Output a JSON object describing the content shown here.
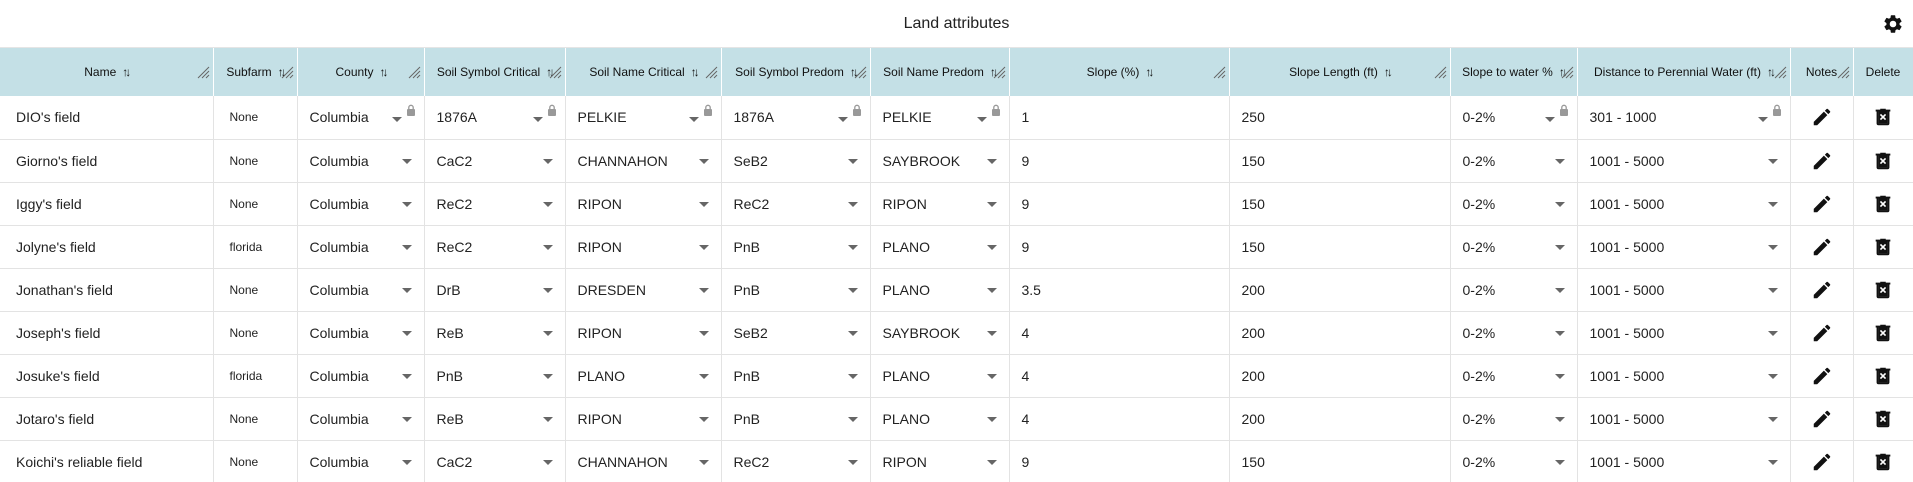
{
  "title": "Land attributes",
  "icons": {
    "settings": "gear-icon",
    "notes": "pencil-icon",
    "delete": "trash-x-icon",
    "lock": "lock-icon",
    "sort": "sort-arrows-icon"
  },
  "headers": [
    "Name",
    "Subfarm",
    "County",
    "Soil Symbol Critical",
    "Soil Name Critical",
    "Soil Symbol Predom",
    "Soil Name Predom",
    "Slope (%)",
    "Slope Length (ft)",
    "Slope to water %",
    "Distance to Perennial Water (ft)",
    "Notes",
    "Delete"
  ],
  "rows": [
    {
      "name": "DIO's field",
      "subfarm": "None",
      "county": "Columbia",
      "ssc": "1876A",
      "snc": "PELKIE",
      "ssp": "1876A",
      "snp": "PELKIE",
      "slope": "1",
      "slope_len": "250",
      "slope_water": "0-2%",
      "distance": "301 - 1000",
      "locked": true
    },
    {
      "name": "Giorno's field",
      "subfarm": "None",
      "county": "Columbia",
      "ssc": "CaC2",
      "snc": "CHANNAHON",
      "ssp": "SeB2",
      "snp": "SAYBROOK",
      "slope": "9",
      "slope_len": "150",
      "slope_water": "0-2%",
      "distance": "1001 - 5000",
      "locked": false
    },
    {
      "name": "Iggy's field",
      "subfarm": "None",
      "county": "Columbia",
      "ssc": "ReC2",
      "snc": "RIPON",
      "ssp": "ReC2",
      "snp": "RIPON",
      "slope": "9",
      "slope_len": "150",
      "slope_water": "0-2%",
      "distance": "1001 - 5000",
      "locked": false
    },
    {
      "name": "Jolyne's field",
      "subfarm": "florida",
      "county": "Columbia",
      "ssc": "ReC2",
      "snc": "RIPON",
      "ssp": "PnB",
      "snp": "PLANO",
      "slope": "9",
      "slope_len": "150",
      "slope_water": "0-2%",
      "distance": "1001 - 5000",
      "locked": false
    },
    {
      "name": "Jonathan's field",
      "subfarm": "None",
      "county": "Columbia",
      "ssc": "DrB",
      "snc": "DRESDEN",
      "ssp": "PnB",
      "snp": "PLANO",
      "slope": "3.5",
      "slope_len": "200",
      "slope_water": "0-2%",
      "distance": "1001 - 5000",
      "locked": false
    },
    {
      "name": "Joseph's field",
      "subfarm": "None",
      "county": "Columbia",
      "ssc": "ReB",
      "snc": "RIPON",
      "ssp": "SeB2",
      "snp": "SAYBROOK",
      "slope": "4",
      "slope_len": "200",
      "slope_water": "0-2%",
      "distance": "1001 - 5000",
      "locked": false
    },
    {
      "name": "Josuke's field",
      "subfarm": "florida",
      "county": "Columbia",
      "ssc": "PnB",
      "snc": "PLANO",
      "ssp": "PnB",
      "snp": "PLANO",
      "slope": "4",
      "slope_len": "200",
      "slope_water": "0-2%",
      "distance": "1001 - 5000",
      "locked": false
    },
    {
      "name": "Jotaro's field",
      "subfarm": "None",
      "county": "Columbia",
      "ssc": "ReB",
      "snc": "RIPON",
      "ssp": "PnB",
      "snp": "PLANO",
      "slope": "4",
      "slope_len": "200",
      "slope_water": "0-2%",
      "distance": "1001 - 5000",
      "locked": false
    },
    {
      "name": "Koichi's reliable field",
      "subfarm": "None",
      "county": "Columbia",
      "ssc": "CaC2",
      "snc": "CHANNAHON",
      "ssp": "ReC2",
      "snp": "RIPON",
      "slope": "9",
      "slope_len": "150",
      "slope_water": "0-2%",
      "distance": "1001 - 5000",
      "locked": false
    }
  ]
}
